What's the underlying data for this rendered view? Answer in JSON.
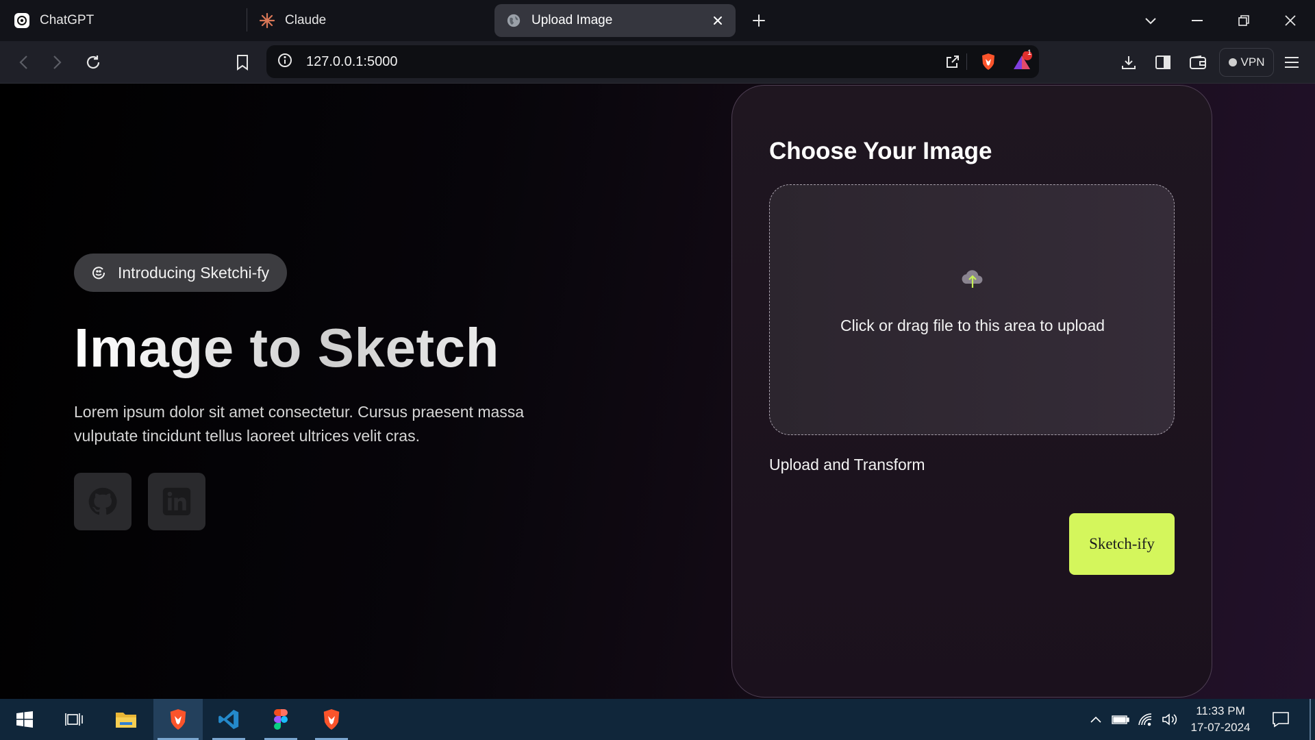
{
  "browser": {
    "tabs": [
      {
        "label": "ChatGPT",
        "icon": "chatgpt-icon"
      },
      {
        "label": "Claude",
        "icon": "claude-icon"
      },
      {
        "label": "Upload Image",
        "icon": "globe-icon",
        "active": true
      }
    ],
    "address": "127.0.0.1:5000",
    "notification_count": "1",
    "vpn_label": "VPN"
  },
  "hero": {
    "badge": "Introducing Sketchi-fy",
    "title": "Image to Sketch",
    "description": "Lorem ipsum dolor sit amet consectetur. Cursus praesent massa vulputate tincidunt tellus laoreet ultrices velit cras.",
    "social": [
      {
        "name": "github-icon"
      },
      {
        "name": "linkedin-icon"
      }
    ]
  },
  "upload_card": {
    "title": "Choose Your Image",
    "dropzone_text": "Click or drag file to this area to upload",
    "label": "Upload and Transform",
    "button": "Sketch-ify"
  },
  "colors": {
    "accent": "#d4f65c",
    "card_border": "#4d3e52",
    "tab_active": "#35363e"
  },
  "taskbar": {
    "time": "11:33 PM",
    "date": "17-07-2024"
  }
}
